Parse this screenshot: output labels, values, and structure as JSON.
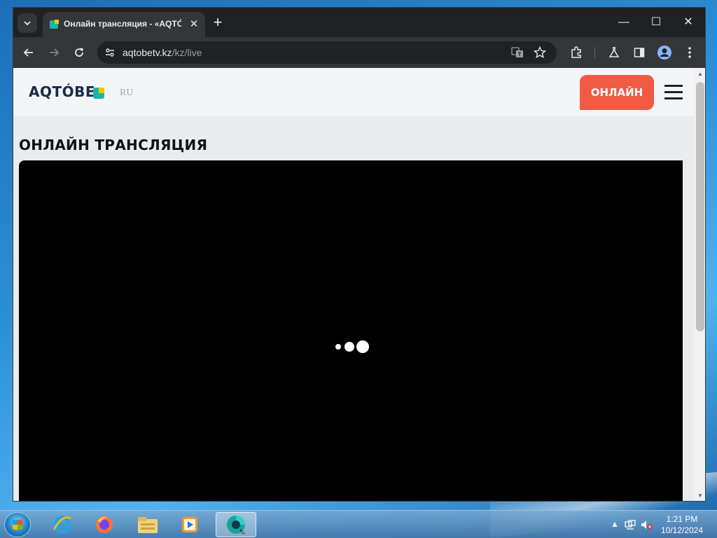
{
  "browser": {
    "tab": {
      "title": "Онлайн трансляция - «AQTÓ(",
      "close_glyph": "✕"
    },
    "new_tab_glyph": "+",
    "window_controls": {
      "minimize": "—",
      "maximize": "☐",
      "close": "✕"
    },
    "address": {
      "domain": "aqtobetv.kz",
      "path": "/kz/live"
    },
    "icons": [
      "tab-search-icon",
      "back-icon",
      "forward-icon",
      "reload-icon",
      "site-info-icon",
      "translate-icon",
      "bookmark-star-icon",
      "extensions-icon",
      "labs-flask-icon",
      "side-panel-icon",
      "profile-icon",
      "menu-icon"
    ]
  },
  "site": {
    "logo_text": "AQTÓBE",
    "language": "RU",
    "online_button": "ОНЛАЙН",
    "page_title": "ОНЛАЙН ТРАНСЛЯЦИЯ",
    "brand_colors": {
      "teal": "#1bb4a8",
      "yellow": "#f5c400",
      "accent": "#f15a43",
      "navy": "#1a2a4a"
    }
  },
  "taskbar": {
    "apps": [
      "start-orb",
      "internet-explorer",
      "firefox",
      "file-explorer",
      "media-player",
      "chrome-browser"
    ],
    "clock": {
      "time": "1:21 PM",
      "date": "10/12/2024"
    }
  }
}
